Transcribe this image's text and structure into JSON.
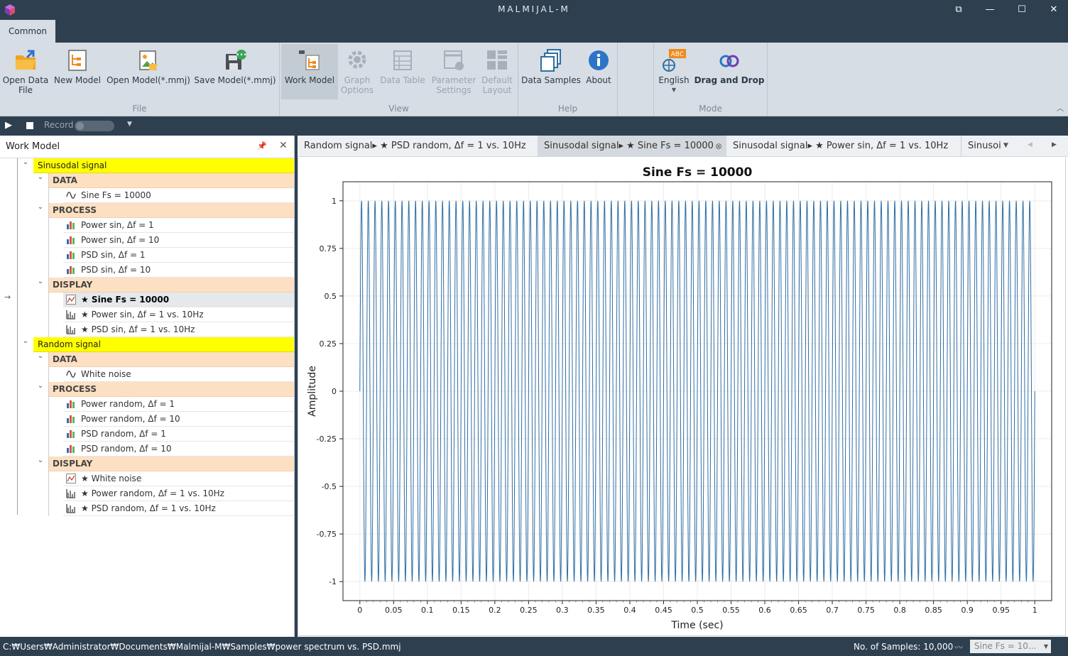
{
  "window": {
    "title": "MALMIJAL-M"
  },
  "ribbon": {
    "tab": "Common",
    "groups": {
      "file": {
        "label": "File",
        "open_data": "Open Data\nFile",
        "new_model": "New Model",
        "open_model": "Open Model(*.mmj)",
        "save_model": "Save Model(*.mmj)"
      },
      "view": {
        "label": "View",
        "work_model": "Work Model",
        "graph_options": "Graph\nOptions",
        "data_table": "Data Table",
        "parameter_settings": "Parameter\nSettings",
        "default_layout": "Default\nLayout"
      },
      "help": {
        "label": "Help",
        "data_samples": "Data Samples",
        "about": "About"
      },
      "mode": {
        "label": "Mode",
        "english": "English",
        "drag_drop": "Drag and Drop",
        "abc_badge": "ABC"
      }
    }
  },
  "toolbar": {
    "record_label": "Record"
  },
  "work_model": {
    "title": "Work Model",
    "groups": [
      {
        "name": "Sinusodal signal",
        "data_label": "DATA",
        "data": [
          "Sine Fs = 10000"
        ],
        "process_label": "PROCESS",
        "process": [
          "Power sin, Δf = 1",
          "Power sin, Δf = 10",
          "PSD sin, Δf = 1",
          "PSD sin, Δf = 10"
        ],
        "display_label": "DISPLAY",
        "display": [
          "★ Sine Fs = 10000",
          "★ Power sin, Δf = 1 vs. 10Hz",
          "★ PSD sin, Δf = 1 vs. 10Hz"
        ]
      },
      {
        "name": "Random signal",
        "data_label": "DATA",
        "data": [
          "White noise"
        ],
        "process_label": "PROCESS",
        "process": [
          "Power random, Δf = 1",
          "Power random, Δf = 10",
          "PSD random, Δf = 1",
          "PSD random, Δf = 10"
        ],
        "display_label": "DISPLAY",
        "display": [
          "★ White noise",
          "★ Power random, Δf = 1 vs. 10Hz",
          "★ PSD random, Δf = 1 vs. 10Hz"
        ]
      }
    ]
  },
  "doc_tabs": [
    {
      "label": "Random signal▸ ★ PSD random, Δf = 1 vs. 10Hz",
      "active": false
    },
    {
      "label": "Sinusodal signal▸ ★ Sine Fs = 10000",
      "active": true
    },
    {
      "label": "Sinusodal signal▸ ★ Power sin, Δf = 1 vs. 10Hz",
      "active": false
    },
    {
      "label": "Sinusoi",
      "active": false
    }
  ],
  "chart_data": {
    "type": "line",
    "title": "Sine Fs = 10000",
    "xlabel": "Time (sec)",
    "ylabel": "Amplitude",
    "xlim": [
      -0.025,
      1.025
    ],
    "ylim": [
      -1.1,
      1.1
    ],
    "x_ticks": [
      "0",
      "0.05",
      "0.1",
      "0.15",
      "0.2",
      "0.25",
      "0.3",
      "0.35",
      "0.4",
      "0.45",
      "0.5",
      "0.55",
      "0.6",
      "0.65",
      "0.7",
      "0.75",
      "0.8",
      "0.85",
      "0.9",
      "0.95",
      "1"
    ],
    "y_ticks": [
      "1",
      "0.75",
      "0.5",
      "0.25",
      "0",
      "-0.25",
      "-0.5",
      "-0.75",
      "-1"
    ],
    "series": [
      {
        "frequency_hz": 100,
        "amplitude": 1,
        "x_start": 0,
        "x_end": 1,
        "color": "#2f6ea3"
      }
    ],
    "grid": true,
    "legend": "none"
  },
  "status": {
    "path": "C:₩Users₩Administrator₩Documents₩Malmijal-M₩Samples₩power spectrum vs. PSD.mmj",
    "samples": "No. of Samples: 10,000",
    "selector": "Sine Fs = 10..."
  },
  "colors": {
    "chrome": "#2e3f50",
    "ribbon": "#d6dde4",
    "group_row": "#ffff00",
    "category_row": "#fde0c2",
    "line": "#2f6ea3"
  }
}
